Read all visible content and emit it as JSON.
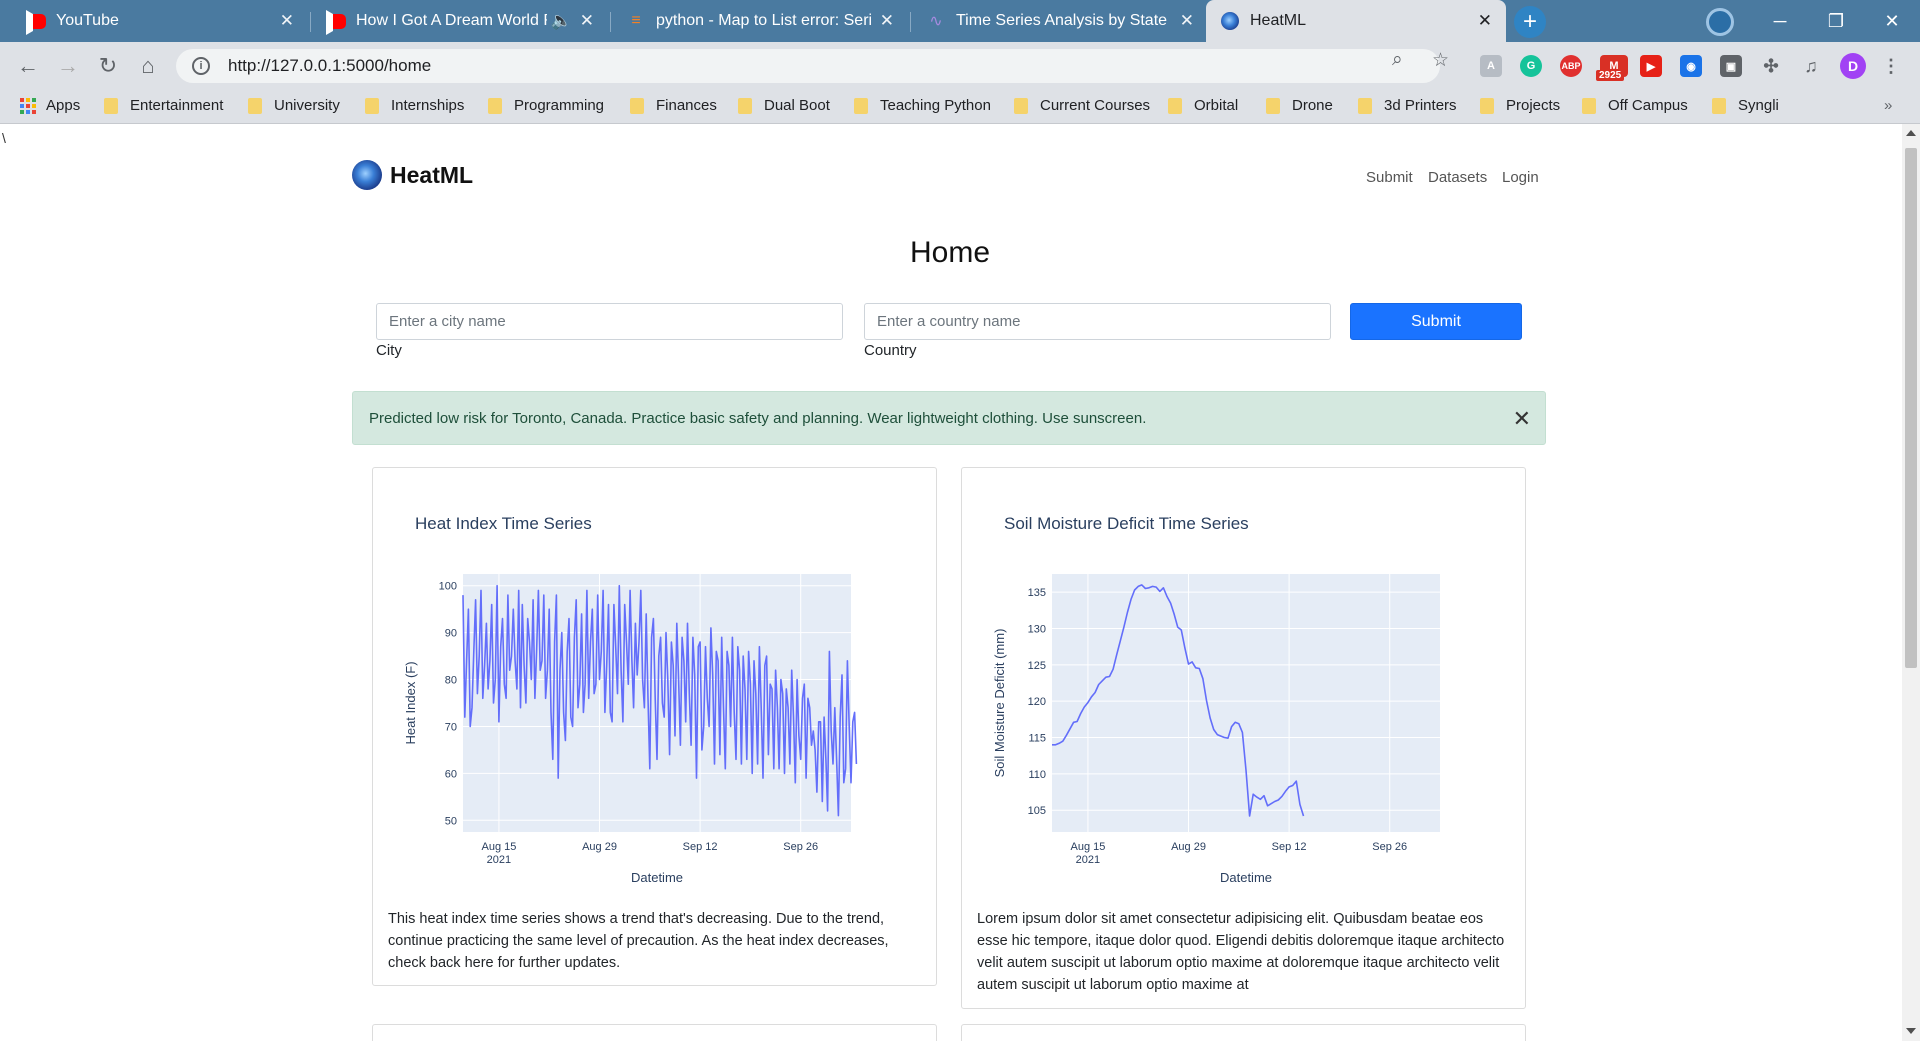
{
  "browser": {
    "tabs": [
      {
        "title": "YouTube",
        "icon": "youtube-icon",
        "active": false
      },
      {
        "title": "How I Got A Dream World R",
        "icon": "youtube-icon",
        "active": false
      },
      {
        "title": "python - Map to List error: Serie",
        "icon": "stackoverflow-icon",
        "active": false
      },
      {
        "title": "Time Series Analysis by State Spa",
        "icon": "chart-icon",
        "active": false
      },
      {
        "title": "HeatML",
        "icon": "heatml-icon",
        "active": true
      }
    ],
    "url": "http://127.0.0.1:5000/home",
    "extension_badge": "2925",
    "profile_initial": "D",
    "bookmarks": [
      "Apps",
      "Entertainment",
      "University",
      "Internships",
      "Programming",
      "Finances",
      "Dual Boot",
      "Teaching Python",
      "Current Courses",
      "Orbital",
      "Drone",
      "3d Printers",
      "Projects",
      "Off Campus",
      "Syngli"
    ],
    "more_bookmarks": "»"
  },
  "page": {
    "stray_text": "\\",
    "brand": "HeatML",
    "nav": [
      "Submit",
      "Datasets",
      "Login"
    ],
    "title": "Home",
    "form": {
      "city_placeholder": "Enter a city name",
      "city_label": "City",
      "country_placeholder": "Enter a country name",
      "country_label": "Country",
      "submit_label": "Submit"
    },
    "alert": "Predicted low risk for Toronto, Canada. Practice basic safety and planning. Wear lightweight clothing. Use sunscreen.",
    "cards": [
      {
        "title": "Heat Index Time Series",
        "text": "This heat index time series shows a trend that's decreasing. Due to the trend, continue practicing the same level of precaution. As the heat index decreases, check back here for further updates."
      },
      {
        "title": "Soil Moisture Deficit Time Series",
        "text": "Lorem ipsum dolor sit amet consectetur adipisicing elit. Quibusdam beatae eos esse hic tempore, itaque dolor quod. Eligendi debitis doloremque itaque architecto velit autem suscipit ut laborum optio maxime at doloremque itaque architecto velit autem suscipit ut laborum optio maxime at"
      }
    ]
  },
  "colors": {
    "series": "#636efa",
    "plot_bg": "#e5ecf6",
    "submit": "#1a73ff",
    "alert_bg": "#d4e8df"
  },
  "chart_data": [
    {
      "type": "line",
      "title": "Heat Index Time Series",
      "xlabel": "Datetime",
      "ylabel": "Heat Index (F)",
      "x_ticks": [
        "Aug 15\n2021",
        "Aug 29",
        "Sep 12",
        "Sep 26"
      ],
      "x_range": [
        "2021-08-10",
        "2021-10-03"
      ],
      "ylim": [
        47.5,
        102.5
      ],
      "y_ticks": [
        50,
        60,
        70,
        80,
        90,
        100
      ],
      "grid": true,
      "series": [
        {
          "x_start": "2021-08-10",
          "step_hours": 6,
          "values": [
            98,
            72,
            84,
            95,
            70,
            74,
            86,
            97,
            77,
            85,
            99,
            76,
            83,
            92,
            78,
            84,
            96,
            75,
            80,
            100,
            71,
            87,
            93,
            79,
            76,
            98,
            82,
            85,
            95,
            84,
            78,
            99,
            74,
            96,
            83,
            75,
            93,
            88,
            80,
            97,
            76,
            86,
            99,
            82,
            84,
            98,
            76,
            82,
            95,
            73,
            63,
            88,
            98,
            59,
            82,
            90,
            73,
            67,
            86,
            93,
            72,
            70,
            89,
            97,
            74,
            79,
            94,
            73,
            79,
            99,
            76,
            88,
            95,
            77,
            79,
            98,
            80,
            86,
            99,
            73,
            83,
            96,
            73,
            71,
            96,
            87,
            77,
            100,
            82,
            71,
            96,
            88,
            79,
            99,
            84,
            74,
            92,
            81,
            88,
            99,
            80,
            74,
            94,
            76,
            61,
            89,
            93,
            76,
            63,
            85,
            89,
            75,
            72,
            90,
            80,
            64,
            88,
            83,
            68,
            92,
            80,
            66,
            89,
            84,
            71,
            92,
            77,
            66,
            89,
            81,
            59,
            87,
            88,
            65,
            70,
            87,
            76,
            70,
            91,
            81,
            62,
            86,
            84,
            64,
            89,
            74,
            61,
            86,
            83,
            70,
            89,
            73,
            63,
            87,
            82,
            62,
            85,
            78,
            63,
            86,
            79,
            60,
            84,
            77,
            62,
            87,
            74,
            59,
            83,
            85,
            64,
            79,
            78,
            61,
            82,
            74,
            61,
            80,
            77,
            60,
            78,
            74,
            62,
            82,
            72,
            58,
            80,
            68,
            63,
            76,
            79,
            59,
            76,
            74,
            66,
            69,
            65,
            56,
            71,
            71,
            54,
            72,
            63,
            52,
            86,
            69,
            62,
            74,
            63,
            51,
            72,
            81,
            58,
            61,
            84,
            70,
            58,
            71,
            73,
            62
          ]
        }
      ]
    },
    {
      "type": "line",
      "title": "Soil Moisture Deficit Time Series",
      "xlabel": "Datetime",
      "ylabel": "Soil Moisture Deficit (mm)",
      "x_ticks": [
        "Aug 15\n2021",
        "Aug 29",
        "Sep 12",
        "Sep 26"
      ],
      "x_range": [
        "2021-08-10",
        "2021-10-03"
      ],
      "ylim": [
        102,
        137.5
      ],
      "y_ticks": [
        105,
        110,
        115,
        120,
        125,
        130,
        135
      ],
      "grid": true,
      "series": [
        {
          "x_start": "2021-08-10",
          "step_hours": 12,
          "values": [
            114,
            114,
            114.2,
            114.5,
            115.3,
            116.2,
            117.1,
            117.2,
            118.3,
            119.2,
            119.8,
            120.6,
            121.2,
            122.3,
            122.8,
            123.3,
            123.4,
            124.4,
            126.4,
            128.3,
            130.2,
            132.2,
            134,
            135.3,
            135.8,
            136,
            135.5,
            135.6,
            135.8,
            135.7,
            135.1,
            135.6,
            134.4,
            133.5,
            132,
            130.2,
            129.8,
            127.3,
            125.1,
            125.4,
            124.6,
            124.5,
            123.1,
            120.1,
            117.7,
            116.1,
            115.4,
            115.2,
            115,
            114.9,
            116.5,
            117.1,
            116.9,
            115.7,
            110.5,
            104.2,
            107.2,
            106.8,
            106.5,
            107,
            105.6,
            105.9,
            106.2,
            106.4,
            106.9,
            107.6,
            108.2,
            108.4,
            109,
            105.8,
            104.2
          ]
        }
      ]
    }
  ]
}
